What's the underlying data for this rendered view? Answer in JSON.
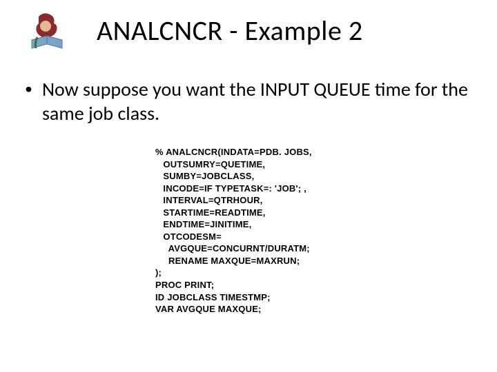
{
  "title": "ANALCNCR - Example 2",
  "bullet_text": "Now suppose you want the INPUT QUEUE time for the same job class.",
  "code_lines": [
    "% ANALCNCR(INDATA=PDB. JOBS,",
    "   OUTSUMRY=QUETIME,",
    "   SUMBY=JOBCLASS,",
    "   INCODE=IF TYPETASK=: 'JOB'; ,",
    "   INTERVAL=QTRHOUR,",
    "   STARTIME=READTIME,",
    "   ENDTIME=JINITIME,",
    "   OTCODESM=",
    "     AVGQUE=CONCURNT/DURATM;",
    "     RENAME MAXQUE=MAXRUN;",
    ");",
    "PROC PRINT;",
    "ID JOBCLASS TIMESTMP;",
    "VAR AVGQUE MAXQUE;"
  ],
  "icon": "user-reading-icon"
}
